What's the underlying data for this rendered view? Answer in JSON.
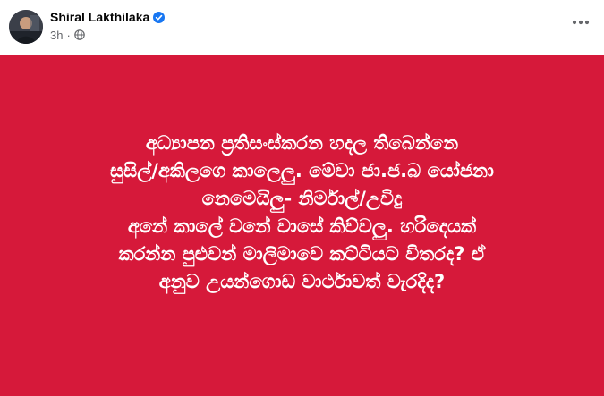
{
  "post": {
    "author": "Shiral Lakthilaka",
    "verified": true,
    "time": "3h",
    "separator": "·",
    "audience_icon": "globe-icon",
    "more_icon": "more-options-icon",
    "background_color": "#d6193a",
    "text_color": "#ffffff",
    "lines": [
      "අධ්‍යාපන ප්‍රතිසංස්කරන හදල තිබෙන්නෙ",
      "සුසිල්/අකිලගෙ කාලෙලු. මේවා ජා.ජ.බ යෝජනා",
      "නෙමෙයිලු- නිර්මාල්/උවිදු",
      "අනේ කාලේ වනේ වාසේ කිව්වලු. හරිදෙයක්",
      "කරන්න පුළුවන් මාලිමාවෙ කට්ටියට විතරද? ඒ",
      "අනුව උයන්ගොඩ වාර්ථාවත් වැරදිද?"
    ]
  }
}
